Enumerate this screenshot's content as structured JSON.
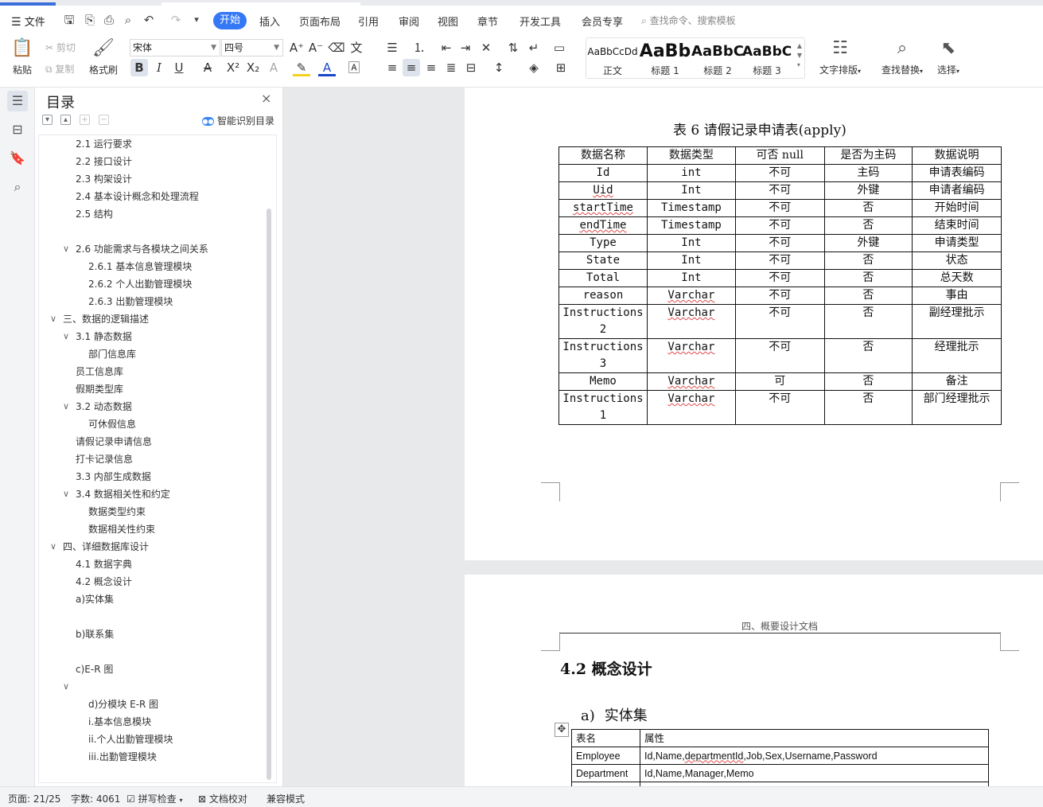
{
  "menu": {
    "file": "文件",
    "tabs": [
      "开始",
      "插入",
      "页面布局",
      "引用",
      "审阅",
      "视图",
      "章节",
      "开发工具",
      "会员专享"
    ],
    "search_placeholder": "查找命令、搜索模板"
  },
  "ribbon": {
    "paste": "粘贴",
    "cut": "剪切",
    "copy": "复制",
    "format_painter": "格式刷",
    "font_name": "宋体",
    "font_size": "四号",
    "styles": [
      {
        "preview": "AaBbCcDd",
        "name": "正文"
      },
      {
        "preview": "AaBb",
        "name": "标题 1"
      },
      {
        "preview": "AaBbC",
        "name": "标题 2"
      },
      {
        "preview": "AaBbC",
        "name": "标题 3"
      }
    ],
    "text_layout": "文字排版",
    "find_replace": "查找替换",
    "select": "选择"
  },
  "toc": {
    "title": "目录",
    "smart_label": "智能识别目录",
    "items": [
      {
        "label": "2.1 运行要求",
        "level": 2,
        "arrow": false
      },
      {
        "label": "2.2 接口设计",
        "level": 2,
        "arrow": false
      },
      {
        "label": "2.3 构架设计",
        "level": 2,
        "arrow": false
      },
      {
        "label": "2.4 基本设计概念和处理流程",
        "level": 2,
        "arrow": false
      },
      {
        "label": "2.5 结构",
        "level": 2,
        "arrow": false
      },
      {
        "label": "",
        "level": 2,
        "arrow": false
      },
      {
        "label": "2.6 功能需求与各模块之间关系",
        "level": 2,
        "arrow": true
      },
      {
        "label": "2.6.1 基本信息管理模块",
        "level": 3,
        "arrow": false
      },
      {
        "label": "2.6.2 个人出勤管理模块",
        "level": 3,
        "arrow": false
      },
      {
        "label": "2.6.3 出勤管理模块",
        "level": 3,
        "arrow": false
      },
      {
        "label": "三、数据的逻辑描述",
        "level": 1,
        "arrow": true
      },
      {
        "label": "3.1  静态数据",
        "level": 2,
        "arrow": true
      },
      {
        "label": "部门信息库",
        "level": 3,
        "arrow": false
      },
      {
        "label": "员工信息库",
        "level": 2,
        "arrow": false
      },
      {
        "label": "假期类型库",
        "level": 2,
        "arrow": false
      },
      {
        "label": "3.2  动态数据",
        "level": 2,
        "arrow": true
      },
      {
        "label": "可休假信息",
        "level": 3,
        "arrow": false
      },
      {
        "label": "请假记录申请信息",
        "level": 2,
        "arrow": false
      },
      {
        "label": "打卡记录信息",
        "level": 2,
        "arrow": false
      },
      {
        "label": "3.3  内部生成数据",
        "level": 2,
        "arrow": false
      },
      {
        "label": "3.4  数据相关性和约定",
        "level": 2,
        "arrow": true
      },
      {
        "label": "数据类型约束",
        "level": 3,
        "arrow": false
      },
      {
        "label": "数据相关性约束",
        "level": 3,
        "arrow": false
      },
      {
        "label": "四、详细数据库设计",
        "level": 1,
        "arrow": true
      },
      {
        "label": "4.1 数据字典",
        "level": 2,
        "arrow": false
      },
      {
        "label": "4.2 概念设计",
        "level": 2,
        "arrow": false
      },
      {
        "label": "a)实体集",
        "level": 2,
        "arrow": false
      },
      {
        "label": "",
        "level": 2,
        "arrow": false
      },
      {
        "label": "b)联系集",
        "level": 2,
        "arrow": false
      },
      {
        "label": "",
        "level": 2,
        "arrow": false
      },
      {
        "label": "c)E-R 图",
        "level": 2,
        "arrow": false
      },
      {
        "label": "",
        "level": 2,
        "arrow": true
      },
      {
        "label": "d)分模块 E-R 图",
        "level": 3,
        "arrow": false
      },
      {
        "label": "i.基本信息模块",
        "level": 3,
        "arrow": false
      },
      {
        "label": "ii.个人出勤管理模块",
        "level": 3,
        "arrow": false
      },
      {
        "label": "iii.出勤管理模块",
        "level": 3,
        "arrow": false
      }
    ]
  },
  "page1": {
    "caption": "表 6 请假记录申请表(apply)",
    "headers": [
      "数据名称",
      "数据类型",
      "可否 null",
      "是否为主码",
      "数据说明"
    ],
    "rows": [
      {
        "name": "Id",
        "type": "int",
        "null": "不可",
        "pk": "主码",
        "desc": "申请表编码",
        "squig_name": false,
        "squig_type": false
      },
      {
        "name": "Uid",
        "type": "Int",
        "null": "不可",
        "pk": "外键",
        "desc": "申请者编码",
        "squig_name": true,
        "squig_type": false
      },
      {
        "name": "startTime",
        "type": "Timestamp",
        "null": "不可",
        "pk": "否",
        "desc": "开始时间",
        "squig_name": true,
        "squig_type": false
      },
      {
        "name": "endTime",
        "type": "Timestamp",
        "null": "不可",
        "pk": "否",
        "desc": "结束时间",
        "squig_name": true,
        "squig_type": false
      },
      {
        "name": "Type",
        "type": "Int",
        "null": "不可",
        "pk": "外键",
        "desc": "申请类型",
        "squig_name": false,
        "squig_type": false
      },
      {
        "name": "State",
        "type": "Int",
        "null": "不可",
        "pk": "否",
        "desc": "状态",
        "squig_name": false,
        "squig_type": false
      },
      {
        "name": "Total",
        "type": "Int",
        "null": "不可",
        "pk": "否",
        "desc": "总天数",
        "squig_name": false,
        "squig_type": false
      },
      {
        "name": "reason",
        "type": "Varchar",
        "null": "不可",
        "pk": "否",
        "desc": "事由",
        "squig_name": false,
        "squig_type": true
      },
      {
        "name": "Instructions 2",
        "type": "Varchar",
        "null": "不可",
        "pk": "否",
        "desc": "副经理批示",
        "squig_name": false,
        "squig_type": true
      },
      {
        "name": "Instructions 3",
        "type": "Varchar",
        "null": "不可",
        "pk": "否",
        "desc": "经理批示",
        "squig_name": false,
        "squig_type": true
      },
      {
        "name": "Memo",
        "type": "Varchar",
        "null": "可",
        "pk": "否",
        "desc": "备注",
        "squig_name": false,
        "squig_type": true
      },
      {
        "name": "Instructions 1",
        "type": "Varchar",
        "null": "不可",
        "pk": "否",
        "desc": "部门经理批示",
        "squig_name": false,
        "squig_type": true
      }
    ]
  },
  "page2": {
    "header": "四、概要设计文档",
    "heading": "4.2 概念设计",
    "subheading_marker": "a)",
    "subheading": "实体集",
    "entity_table": {
      "headers": [
        "表名",
        "属性"
      ],
      "rows": [
        [
          "Employee",
          "Id,Name,departmentId,Job,Sex,Username,Password"
        ],
        [
          "Department",
          "Id,Name,Manager,Memo"
        ]
      ]
    }
  },
  "status": {
    "page": "页面: 21/25",
    "words": "字数: 4061",
    "spell": "拼写检查",
    "proof": "文档校对",
    "compat": "兼容模式"
  }
}
